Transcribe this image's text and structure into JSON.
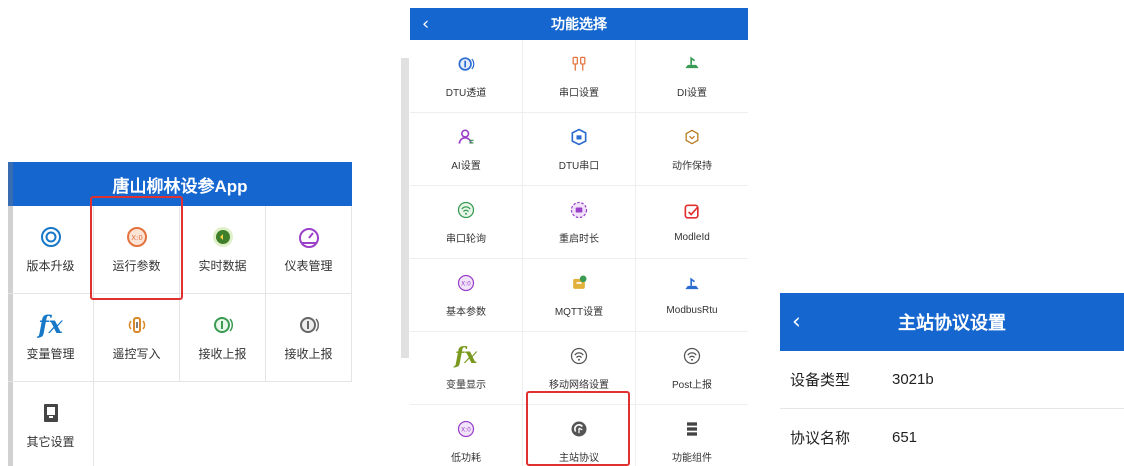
{
  "screen1": {
    "title": "唐山柳林设参App",
    "items": [
      {
        "label": "版本升级",
        "icon": "upgrade-icon"
      },
      {
        "label": "运行参数",
        "icon": "parameters-icon"
      },
      {
        "label": "实时数据",
        "icon": "realtime-data-icon"
      },
      {
        "label": "仪表管理",
        "icon": "gauge-icon"
      },
      {
        "label": "变量管理",
        "icon": "fx-icon"
      },
      {
        "label": "遥控写入",
        "icon": "remote-write-icon"
      },
      {
        "label": "接收上报",
        "icon": "report-icon"
      },
      {
        "label": "接收上报",
        "icon": "report-icon"
      },
      {
        "label": "其它设置",
        "icon": "other-settings-icon"
      }
    ]
  },
  "screen2": {
    "title": "功能选择",
    "items": [
      {
        "label": "DTU透道",
        "icon": "dtu-channel-icon"
      },
      {
        "label": "串口设置",
        "icon": "serial-port-icon"
      },
      {
        "label": "DI设置",
        "icon": "di-icon"
      },
      {
        "label": "AI设置",
        "icon": "ai-icon"
      },
      {
        "label": "DTU串口",
        "icon": "dtu-serial-icon"
      },
      {
        "label": "动作保持",
        "icon": "action-hold-icon"
      },
      {
        "label": "串口轮询",
        "icon": "serial-poll-icon"
      },
      {
        "label": "重启时长",
        "icon": "restart-time-icon"
      },
      {
        "label": "ModleId",
        "icon": "model-id-icon"
      },
      {
        "label": "基本参数",
        "icon": "basic-params-icon"
      },
      {
        "label": "MQTT设置",
        "icon": "mqtt-icon"
      },
      {
        "label": "ModbusRtu",
        "icon": "modbus-icon"
      },
      {
        "label": "变量显示",
        "icon": "fx-icon"
      },
      {
        "label": "移动网络设置",
        "icon": "mobile-network-icon"
      },
      {
        "label": "Post上报",
        "icon": "post-report-icon"
      },
      {
        "label": "低功耗",
        "icon": "low-power-icon"
      },
      {
        "label": "主站协议",
        "icon": "master-protocol-icon"
      },
      {
        "label": "功能组件",
        "icon": "components-icon"
      }
    ]
  },
  "screen3": {
    "title": "主站协议设置",
    "rows": [
      {
        "key": "设备类型",
        "value": "3021b"
      },
      {
        "key": "协议名称",
        "value": "651"
      }
    ]
  },
  "colors": {
    "header_blue": "#1566cf",
    "highlight_red": "#e0302f"
  }
}
